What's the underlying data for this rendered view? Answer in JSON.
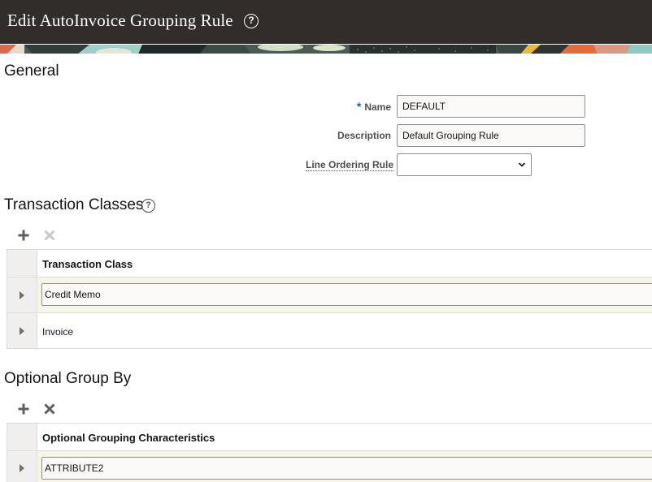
{
  "header": {
    "title": "Edit AutoInvoice Grouping Rule",
    "help_glyph": "?"
  },
  "general": {
    "section_title": "General",
    "name": {
      "label": "Name",
      "required_marker": "*",
      "value": "DEFAULT"
    },
    "description": {
      "label": "Description",
      "value": "Default Grouping Rule"
    },
    "line_ordering_rule": {
      "label": "Line Ordering Rule",
      "value": ""
    }
  },
  "transaction_classes": {
    "section_title": "Transaction Classes",
    "help_glyph": "?",
    "column_header": "Transaction Class",
    "rows": [
      {
        "value": "Credit Memo",
        "selected": true
      },
      {
        "value": "Invoice",
        "selected": false
      }
    ]
  },
  "optional_group_by": {
    "section_title": "Optional Group By",
    "column_header": "Optional Grouping Characteristics",
    "rows": [
      {
        "value": "ATTRIBUTE2",
        "selected": true
      }
    ]
  },
  "icons": {
    "help": "help-icon",
    "add": "add-icon",
    "delete": "delete-icon",
    "expand": "expand-row-icon",
    "dropdown": "chevron-down-icon"
  },
  "colors": {
    "header_bg": "#312d2a",
    "selected_row_bg": "#f7f5e8",
    "required_marker": "#1f5fa0"
  }
}
